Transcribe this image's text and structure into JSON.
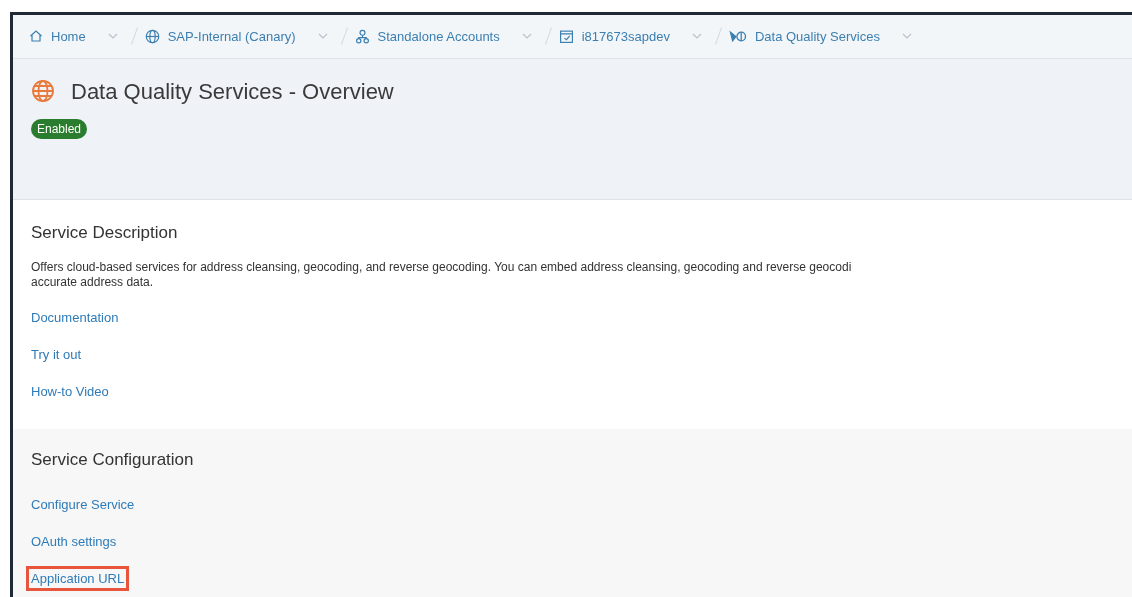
{
  "breadcrumbs": [
    {
      "kind": "home",
      "label": "Home"
    },
    {
      "kind": "globe",
      "label": "SAP-Internal (Canary)"
    },
    {
      "kind": "people",
      "label": "Standalone Accounts"
    },
    {
      "kind": "subaccount",
      "label": "i817673sapdev"
    },
    {
      "kind": "service",
      "label": "Data Quality Services"
    }
  ],
  "header": {
    "title": "Data Quality Services - Overview",
    "status": "Enabled"
  },
  "sections": [
    {
      "title": "Service Description",
      "description_lines": [
        "Offers cloud-based services for address cleansing, geocoding, and reverse geocoding. You can embed address cleansing, geocoding and reverse geocodi",
        "accurate address data."
      ],
      "links": [
        {
          "label": "Documentation",
          "highlighted": false
        },
        {
          "label": "Try it out",
          "highlighted": false
        },
        {
          "label": "How-to Video",
          "highlighted": false
        }
      ]
    },
    {
      "title": "Service Configuration",
      "links": [
        {
          "label": "Configure Service",
          "highlighted": false
        },
        {
          "label": "OAuth settings",
          "highlighted": false
        },
        {
          "label": "Application URL",
          "highlighted": true
        }
      ]
    }
  ]
}
